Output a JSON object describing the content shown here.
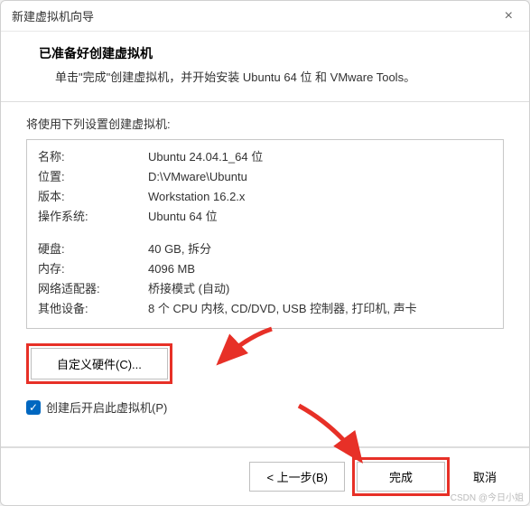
{
  "titlebar": {
    "title": "新建虚拟机向导",
    "close": "×"
  },
  "header": {
    "title": "已准备好创建虚拟机",
    "subtitle": "单击\"完成\"创建虚拟机，并开始安装 Ubuntu 64 位 和 VMware Tools。"
  },
  "main": {
    "settings_label": "将使用下列设置创建虚拟机:",
    "rows1": [
      {
        "key": "名称:",
        "val": "Ubuntu 24.04.1_64 位"
      },
      {
        "key": "位置:",
        "val": "D:\\VMware\\Ubuntu"
      },
      {
        "key": "版本:",
        "val": "Workstation 16.2.x"
      },
      {
        "key": "操作系统:",
        "val": "Ubuntu 64 位"
      }
    ],
    "rows2": [
      {
        "key": "硬盘:",
        "val": "40 GB, 拆分"
      },
      {
        "key": "内存:",
        "val": "4096 MB"
      },
      {
        "key": "网络适配器:",
        "val": "桥接模式 (自动)"
      },
      {
        "key": "其他设备:",
        "val": "8 个 CPU 内核, CD/DVD, USB 控制器, 打印机, 声卡"
      }
    ],
    "customize_btn": "自定义硬件(C)...",
    "checkbox_label": "创建后开启此虚拟机(P)"
  },
  "footer": {
    "back": "< 上一步(B)",
    "finish": "完成",
    "cancel": "取消"
  },
  "watermark": "CSDN @今日小姐"
}
